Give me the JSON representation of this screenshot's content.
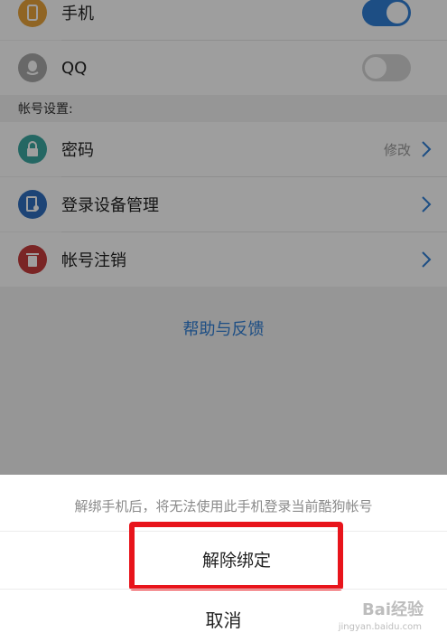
{
  "accounts": {
    "phone": {
      "label": "手机",
      "toggle_on": true
    },
    "qq": {
      "label": "QQ",
      "toggle_on": false
    }
  },
  "section_title": "帐号设置:",
  "settings": [
    {
      "label": "密码",
      "hint": "修改",
      "icon": "lock-icon"
    },
    {
      "label": "登录设备管理",
      "hint": "",
      "icon": "device-icon"
    },
    {
      "label": "帐号注销",
      "hint": "",
      "icon": "trash-icon"
    }
  ],
  "help_link": "帮助与反馈",
  "sheet": {
    "message": "解绑手机后，将无法使用此手机登录当前酷狗帐号",
    "unbind_label": "解除绑定",
    "cancel_label": "取消"
  },
  "watermark": {
    "text": "Bai经验",
    "sub": "jingyan.baidu.com"
  },
  "colors": {
    "toggle_on": "#2f7fd6",
    "toggle_off": "#d6d6d6",
    "phone_icon": "#e8a33a",
    "qq_icon": "#a9a9a9",
    "lock_icon": "#3aa7a0",
    "device_icon": "#2f6fbf",
    "trash_icon": "#c63c3c",
    "link": "#2f7fd6",
    "highlight": "#e8141b"
  }
}
